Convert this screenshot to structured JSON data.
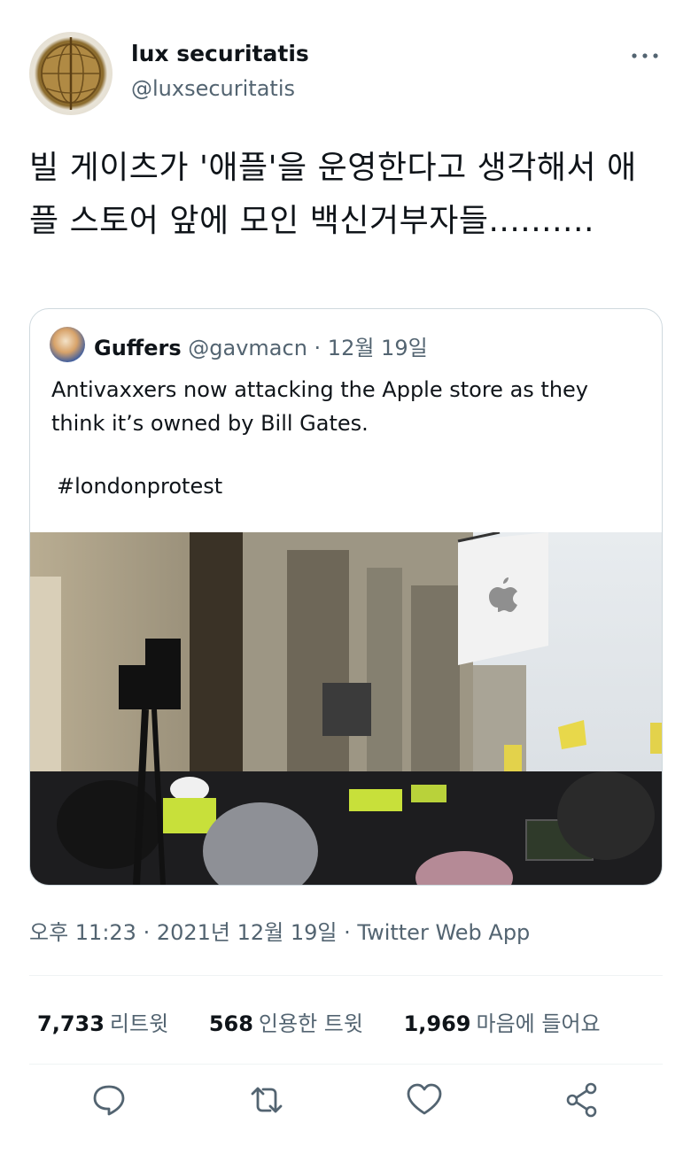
{
  "author": {
    "name": "lux securitatis",
    "handle": "@luxsecuritatis"
  },
  "tweet": {
    "text": "빌 게이츠가 '애플'을 운영한다고 생각해서 애플 스토어 앞에 모인 백신거부자들..........",
    "timestamp": "오후 11:23 · 2021년 12월 19일 · Twitter Web App"
  },
  "quoted": {
    "name": "Guffers",
    "handle": "@gavmacn",
    "date": "· 12월 19일",
    "text": "Antivaxxers now attacking the Apple store as they think it’s owned by Bill Gates.",
    "hashtag": "#londonprotest"
  },
  "stats": {
    "retweets_count": "7,733",
    "retweets_label": "리트윗",
    "quotes_count": "568",
    "quotes_label": "인용한 트윗",
    "likes_count": "1,969",
    "likes_label": "마음에 들어요"
  },
  "icons": {
    "more": "more-icon",
    "reply": "reply-icon",
    "retweet": "retweet-icon",
    "like": "like-icon",
    "share": "share-icon"
  },
  "colors": {
    "text": "#0f1419",
    "secondary": "#536471",
    "border": "#cfd9de"
  }
}
